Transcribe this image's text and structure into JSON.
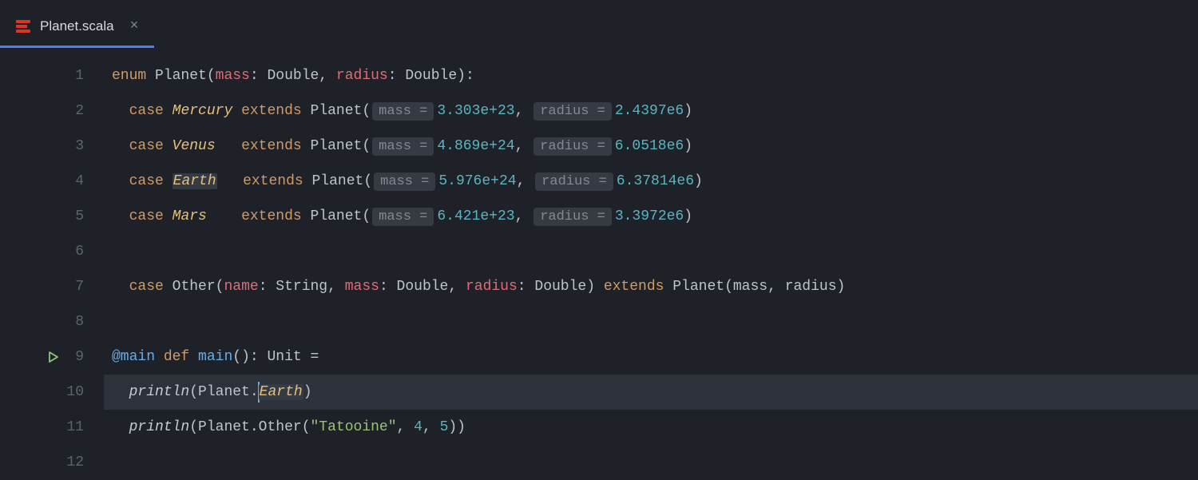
{
  "tab": {
    "filename": "Planet.scala",
    "close_glyph": "×"
  },
  "gutter": {
    "lines": [
      "1",
      "2",
      "3",
      "4",
      "5",
      "6",
      "7",
      "8",
      "9",
      "10",
      "11",
      "12"
    ],
    "run_on_line_index": 8
  },
  "code": {
    "kw_enum": "enum",
    "kw_case": "case",
    "kw_extends": "extends",
    "kw_def": "def",
    "type_double": "Double",
    "type_string": "String",
    "type_unit": "Unit",
    "id_planet": "Planet",
    "id_other": "Other",
    "param_mass": "mass",
    "param_radius": "radius",
    "param_name": "name",
    "hint_mass": "mass =",
    "hint_radius": "radius =",
    "mercury": {
      "name": "Mercury",
      "mass": "3.303e+23",
      "radius": "2.4397e6",
      "pad": " "
    },
    "venus": {
      "name": "Venus",
      "mass": "4.869e+24",
      "radius": "6.0518e6",
      "pad": "   "
    },
    "earth": {
      "name": "Earth",
      "mass": "5.976e+24",
      "radius": "6.37814e6",
      "pad": "   "
    },
    "mars": {
      "name": "Mars",
      "mass": "6.421e+23",
      "radius": "3.3972e6",
      "pad": "    "
    },
    "main_ann": "@main",
    "main_name": "main",
    "println": "println",
    "earth_ref": "Earth",
    "str_tatooine": "\"Tatooine\"",
    "num_4": "4",
    "num_5": "5"
  }
}
